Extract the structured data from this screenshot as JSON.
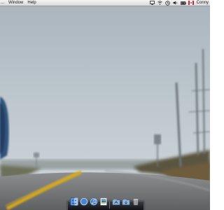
{
  "menubar": {
    "items": [
      {
        "label": "...",
        "name": "menu-item-overflow"
      },
      {
        "label": "Window",
        "name": "menu-item-window"
      },
      {
        "label": "Help",
        "name": "menu-item-help"
      }
    ],
    "status_icons": [
      "screen-mirroring-icon",
      "wifi-icon",
      "time-machine-icon",
      "volume-icon",
      "battery-icon",
      "flag-icon"
    ],
    "extra_text": "Conny"
  },
  "dock": {
    "apps": [
      "finder-icon",
      "safari-icon",
      "itunes-icon",
      "preview-icon"
    ],
    "folders": [
      "applications-folder-icon",
      "downloads-folder-icon",
      "trash-icon"
    ]
  },
  "colors": {
    "menubar_bg": "#e5e5e5",
    "sky": "#b8c2ca",
    "road": "#767778",
    "center_line": "#d2a71c",
    "dock_bg": "#1d1f23"
  }
}
